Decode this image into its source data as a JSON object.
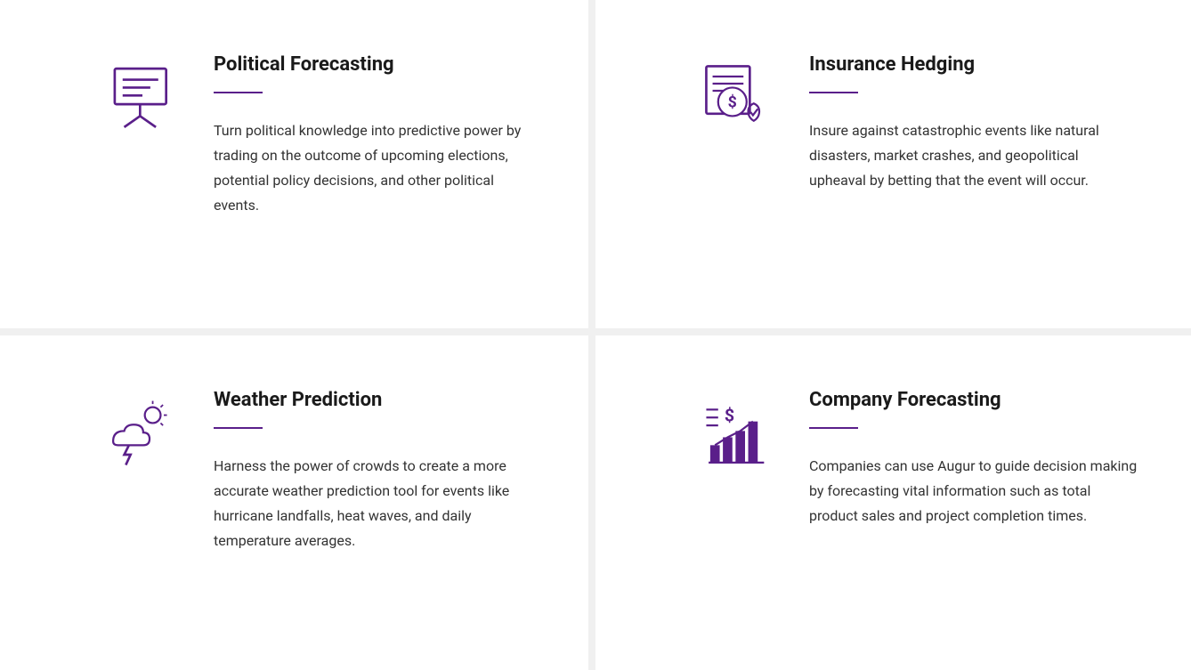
{
  "cards": [
    {
      "id": "political-forecasting",
      "title": "Political Forecasting",
      "description": "Turn political knowledge into predictive power by trading on the outcome of upcoming elections, potential policy decisions, and other political events.",
      "icon": "presentation-chart"
    },
    {
      "id": "insurance-hedging",
      "title": "Insurance Hedging",
      "description": "Insure against catastrophic events like natural disasters, market crashes, and geopolitical upheaval by betting that the event will occur.",
      "icon": "money-shield"
    },
    {
      "id": "weather-prediction",
      "title": "Weather Prediction",
      "description": "Harness the power of crowds to create a more accurate weather prediction tool for events like hurricane landfalls, heat waves, and daily temperature averages.",
      "icon": "weather-storm"
    },
    {
      "id": "company-forecasting",
      "title": "Company Forecasting",
      "description": "Companies can use Augur to guide decision making by forecasting vital information such as total product sales and project completion times.",
      "icon": "bar-chart"
    }
  ]
}
